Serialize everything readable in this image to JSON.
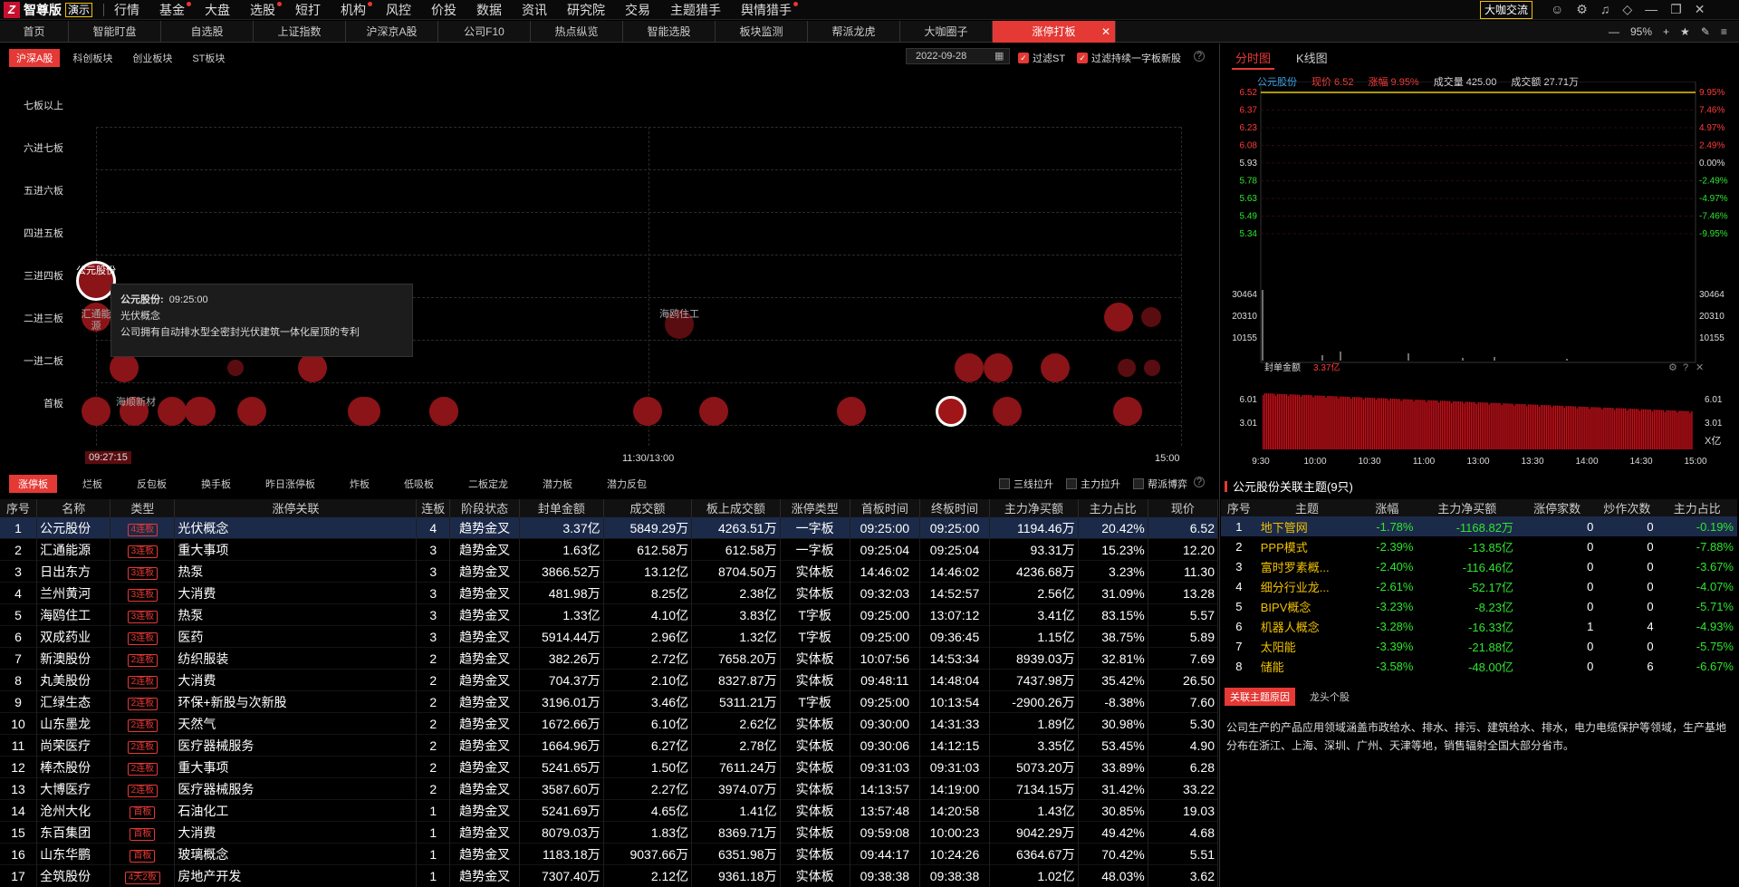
{
  "app": {
    "logo": "Z",
    "name": "智尊版",
    "demo": "演示"
  },
  "menu": [
    {
      "label": "行情",
      "dot": false
    },
    {
      "label": "基金",
      "dot": true
    },
    {
      "label": "大盘",
      "dot": false
    },
    {
      "label": "选股",
      "dot": true
    },
    {
      "label": "短打",
      "dot": false
    },
    {
      "label": "机构",
      "dot": true
    },
    {
      "label": "风控",
      "dot": false
    },
    {
      "label": "价投",
      "dot": false
    },
    {
      "label": "数据",
      "dot": false
    },
    {
      "label": "资讯",
      "dot": false
    },
    {
      "label": "研究院",
      "dot": false
    },
    {
      "label": "交易",
      "dot": false
    },
    {
      "label": "主题猎手",
      "dot": false
    },
    {
      "label": "舆情猎手",
      "dot": true
    }
  ],
  "daka": "大咖交流",
  "tabs": [
    "首页",
    "智能盯盘",
    "自选股",
    "上证指数",
    "沪深京A股",
    "公司F10",
    "热点纵览",
    "智能选股",
    "板块监测",
    "帮派龙虎",
    "大咖圈子",
    "涨停打板"
  ],
  "zoom": "95%",
  "subtabs": [
    "沪深A股",
    "科创板块",
    "创业板块",
    "ST板块"
  ],
  "date": "2022-09-28",
  "filters": {
    "st": "过滤ST",
    "yizi": "过滤持续一字板新股"
  },
  "levels": [
    "七板以上",
    "六进七板",
    "五进六板",
    "四进五板",
    "三进四板",
    "二进三板",
    "一进二板",
    "首板"
  ],
  "bubble_labels": {
    "gongyuan": "公元股份",
    "huitong": "汇通能源",
    "haiou": "海鸥住工",
    "haoyang": "海顺新材"
  },
  "tooltip": {
    "name": "公元股份:",
    "time": "09:25:00",
    "concept": "光伏概念",
    "desc": "公司拥有自动排水型全密封光伏建筑一体化屋顶的专利"
  },
  "time_axis": {
    "start": "09:27:15",
    "mid": "11:30/13:00",
    "end": "15:00"
  },
  "bottom_tabs": [
    "涨停板",
    "烂板",
    "反包板",
    "换手板",
    "昨日涨停板",
    "炸板",
    "低吸板",
    "二板定龙",
    "潜力板",
    "潜力反包"
  ],
  "right_checks": [
    "三线拉升",
    "主力拉升",
    "帮派博弈"
  ],
  "table": {
    "headers": [
      "序号",
      "名称",
      "类型",
      "涨停关联",
      "连板",
      "阶段状态",
      "封单金额",
      "成交额",
      "板上成交额",
      "涨停类型",
      "首板时间",
      "终板时间",
      "主力净买额",
      "主力占比",
      "现价"
    ],
    "rows": [
      [
        "1",
        "公元股份",
        "4连板",
        "光伏概念",
        "4",
        "趋势金叉",
        "3.37亿",
        "5849.29万",
        "4263.51万",
        "一字板",
        "09:25:00",
        "09:25:00",
        "1194.46万",
        "20.42%",
        "6.52"
      ],
      [
        "2",
        "汇通能源",
        "3连板",
        "重大事项",
        "3",
        "趋势金叉",
        "1.63亿",
        "612.58万",
        "612.58万",
        "一字板",
        "09:25:04",
        "09:25:04",
        "93.31万",
        "15.23%",
        "12.20"
      ],
      [
        "3",
        "日出东方",
        "3连板",
        "热泵",
        "3",
        "趋势金叉",
        "3866.52万",
        "13.12亿",
        "8704.50万",
        "实体板",
        "14:46:02",
        "14:46:02",
        "4236.68万",
        "3.23%",
        "11.30"
      ],
      [
        "4",
        "兰州黄河",
        "3连板",
        "大消费",
        "3",
        "趋势金叉",
        "481.98万",
        "8.25亿",
        "2.38亿",
        "实体板",
        "09:32:03",
        "14:52:57",
        "2.56亿",
        "31.09%",
        "13.28"
      ],
      [
        "5",
        "海鸥住工",
        "3连板",
        "热泵",
        "3",
        "趋势金叉",
        "1.33亿",
        "4.10亿",
        "3.83亿",
        "T字板",
        "09:25:00",
        "13:07:12",
        "3.41亿",
        "83.15%",
        "5.57"
      ],
      [
        "6",
        "双成药业",
        "3连板",
        "医药",
        "3",
        "趋势金叉",
        "5914.44万",
        "2.96亿",
        "1.32亿",
        "T字板",
        "09:25:00",
        "09:36:45",
        "1.15亿",
        "38.75%",
        "5.89"
      ],
      [
        "7",
        "新澳股份",
        "2连板",
        "纺织服装",
        "2",
        "趋势金叉",
        "382.26万",
        "2.72亿",
        "7658.20万",
        "实体板",
        "10:07:56",
        "14:53:34",
        "8939.03万",
        "32.81%",
        "7.69"
      ],
      [
        "8",
        "丸美股份",
        "2连板",
        "大消费",
        "2",
        "趋势金叉",
        "704.37万",
        "2.10亿",
        "8327.87万",
        "实体板",
        "09:48:11",
        "14:48:04",
        "7437.98万",
        "35.42%",
        "26.50"
      ],
      [
        "9",
        "汇绿生态",
        "2连板",
        "环保+新股与次新股",
        "2",
        "趋势金叉",
        "3196.01万",
        "3.46亿",
        "5311.21万",
        "T字板",
        "09:25:00",
        "10:13:54",
        "-2900.26万",
        "-8.38%",
        "7.60"
      ],
      [
        "10",
        "山东墨龙",
        "2连板",
        "天然气",
        "2",
        "趋势金叉",
        "1672.66万",
        "6.10亿",
        "2.62亿",
        "实体板",
        "09:30:00",
        "14:31:33",
        "1.89亿",
        "30.98%",
        "5.30"
      ],
      [
        "11",
        "尚荣医疗",
        "2连板",
        "医疗器械服务",
        "2",
        "趋势金叉",
        "1664.96万",
        "6.27亿",
        "2.78亿",
        "实体板",
        "09:30:06",
        "14:12:15",
        "3.35亿",
        "53.45%",
        "4.90"
      ],
      [
        "12",
        "棒杰股份",
        "2连板",
        "重大事项",
        "2",
        "趋势金叉",
        "5241.65万",
        "1.50亿",
        "7611.24万",
        "实体板",
        "09:31:03",
        "09:31:03",
        "5073.20万",
        "33.89%",
        "6.28"
      ],
      [
        "13",
        "大博医疗",
        "2连板",
        "医疗器械服务",
        "2",
        "趋势金叉",
        "3587.60万",
        "2.27亿",
        "3974.07万",
        "实体板",
        "14:13:57",
        "14:19:00",
        "7134.15万",
        "31.42%",
        "33.22"
      ],
      [
        "14",
        "沧州大化",
        "首板",
        "石油化工",
        "1",
        "趋势金叉",
        "5241.69万",
        "4.65亿",
        "1.41亿",
        "实体板",
        "13:57:48",
        "14:20:58",
        "1.43亿",
        "30.85%",
        "19.03"
      ],
      [
        "15",
        "东百集团",
        "首板",
        "大消费",
        "1",
        "趋势金叉",
        "8079.03万",
        "1.83亿",
        "8369.71万",
        "实体板",
        "09:59:08",
        "10:00:23",
        "9042.29万",
        "49.42%",
        "4.68"
      ],
      [
        "16",
        "山东华鹏",
        "首板",
        "玻璃概念",
        "1",
        "趋势金叉",
        "1183.18万",
        "9037.66万",
        "6351.98万",
        "实体板",
        "09:44:17",
        "10:24:26",
        "6364.67万",
        "70.42%",
        "5.51"
      ],
      [
        "17",
        "全筑股份",
        "4天2板",
        "房地产开发",
        "1",
        "趋势金叉",
        "7307.40万",
        "2.12亿",
        "9361.18万",
        "实体板",
        "09:38:38",
        "09:38:38",
        "1.02亿",
        "48.03%",
        "3.62"
      ]
    ]
  },
  "right": {
    "tabs": [
      "分时图",
      "K线图"
    ],
    "info": {
      "name": "公元股份",
      "price": "现价 6.52",
      "chg": "涨幅 9.95%",
      "vol": "成交量 425.00",
      "amt": "成交额 27.71万"
    },
    "price_ticks": [
      "6.52",
      "6.37",
      "6.23",
      "6.08",
      "5.93",
      "5.78",
      "5.63",
      "5.49",
      "5.34"
    ],
    "pct_ticks": [
      "9.95%",
      "7.46%",
      "4.97%",
      "2.49%",
      "0.00%",
      "-2.49%",
      "-4.97%",
      "-7.46%",
      "-9.95%"
    ],
    "vol_ticks": [
      "30464",
      "20310",
      "10155"
    ],
    "seal_label": "封单金额",
    "seal_value": "3.37亿",
    "seal_ticks": [
      "6.01",
      "3.01"
    ],
    "seal_unit": "X亿",
    "time_ticks": [
      "9:30",
      "10:00",
      "10:30",
      "11:00",
      "13:00",
      "13:30",
      "14:00",
      "14:30",
      "15:00"
    ],
    "theme_title": "公元股份关联主题(9只)",
    "theme_headers": [
      "序号",
      "主题",
      "涨幅",
      "主力净买额",
      "涨停家数",
      "炒作次数",
      "主力占比"
    ],
    "themes": [
      [
        "1",
        "地下管网",
        "-1.78%",
        "-1168.82万",
        "0",
        "0",
        "-0.19%"
      ],
      [
        "2",
        "PPP模式",
        "-2.39%",
        "-13.85亿",
        "0",
        "0",
        "-7.88%"
      ],
      [
        "3",
        "富时罗素概...",
        "-2.40%",
        "-116.46亿",
        "0",
        "0",
        "-3.67%"
      ],
      [
        "4",
        "细分行业龙...",
        "-2.61%",
        "-52.17亿",
        "0",
        "0",
        "-4.07%"
      ],
      [
        "5",
        "BIPV概念",
        "-3.23%",
        "-8.23亿",
        "0",
        "0",
        "-5.71%"
      ],
      [
        "6",
        "机器人概念",
        "-3.28%",
        "-16.33亿",
        "1",
        "4",
        "-4.93%"
      ],
      [
        "7",
        "太阳能",
        "-3.39%",
        "-21.88亿",
        "0",
        "0",
        "-5.75%"
      ],
      [
        "8",
        "储能",
        "-3.58%",
        "-48.00亿",
        "0",
        "6",
        "-6.67%"
      ]
    ],
    "ctabs": [
      "关联主题原因",
      "龙头个股"
    ],
    "desc": "公司生产的产品应用领域涵盖市政给水、排水、排污、建筑给水、排水，电力电缆保护等领域，生产基地分布在浙江、上海、深圳、广州、天津等地，销售辐射全国大部分省市。"
  },
  "colors": {
    "accent": "#e53935",
    "up": "#ff3b3b",
    "down": "#2ee62e",
    "link": "#3fa9f5"
  }
}
